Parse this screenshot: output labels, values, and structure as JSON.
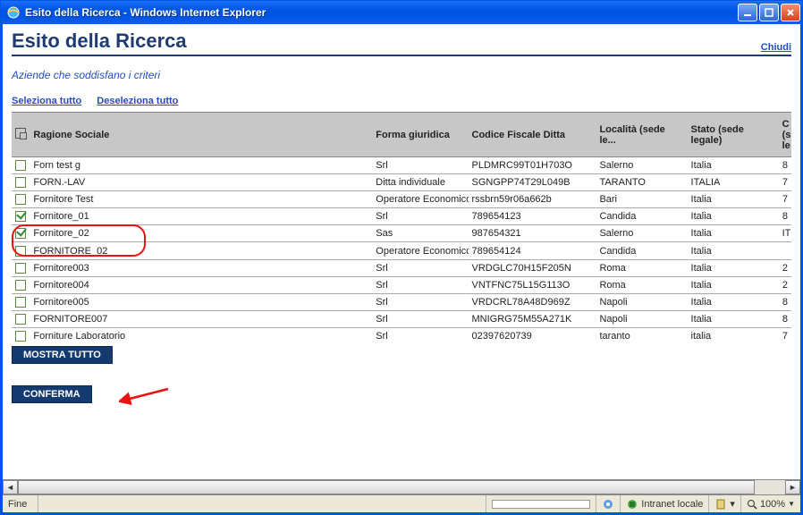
{
  "window": {
    "title": "Esito della Ricerca - Windows Internet Explorer"
  },
  "page": {
    "title": "Esito della Ricerca",
    "close_link": "Chiudi",
    "subtitle": "Aziende che soddisfano i criteri",
    "select_all": "Seleziona tutto",
    "deselect_all": "Deseleziona tutto"
  },
  "grid": {
    "headers": {
      "ragione": "Ragione Sociale",
      "forma": "Forma giuridica",
      "codice": "Codice Fiscale Ditta",
      "localita": "Località (sede le...",
      "stato": "Stato (sede legale)",
      "last": "C (s le"
    },
    "rows": [
      {
        "checked": false,
        "ragione": "Forn test g",
        "forma": "Srl",
        "codice": "PLDMRC99T01H703O",
        "localita": "Salerno",
        "stato": "Italia",
        "last": "8"
      },
      {
        "checked": false,
        "ragione": "FORN.-LAV",
        "forma": "Ditta individuale",
        "codice": "SGNGPP74T29L049B",
        "localita": "TARANTO",
        "stato": "ITALIA",
        "last": "7"
      },
      {
        "checked": false,
        "ragione": "Fornitore Test",
        "forma": "Operatore Economico Direttiva Europea",
        "codice": "rssbrn59r06a662b",
        "localita": "Bari",
        "stato": "Italia",
        "last": "7"
      },
      {
        "checked": true,
        "ragione": "Fornitore_01",
        "forma": "Srl",
        "codice": "789654123",
        "localita": "Candida",
        "stato": "Italia",
        "last": "8"
      },
      {
        "checked": true,
        "ragione": "Fornitore_02",
        "forma": "Sas",
        "codice": "987654321",
        "localita": "Salerno",
        "stato": "Italia",
        "last": "IT"
      },
      {
        "checked": false,
        "ragione": "FORNITORE_02",
        "forma": "Operatore Economico Direttiva Europea",
        "codice": "789654124",
        "localita": "Candida",
        "stato": "Italia",
        "last": ""
      },
      {
        "checked": false,
        "ragione": "Fornitore003",
        "forma": "Srl",
        "codice": "VRDGLC70H15F205N",
        "localita": "Roma",
        "stato": "Italia",
        "last": "2"
      },
      {
        "checked": false,
        "ragione": "Fornitore004",
        "forma": "Srl",
        "codice": "VNTFNC75L15G113O",
        "localita": "Roma",
        "stato": "Italia",
        "last": "2"
      },
      {
        "checked": false,
        "ragione": "Fornitore005",
        "forma": "Srl",
        "codice": "VRDCRL78A48D969Z",
        "localita": "Napoli",
        "stato": "Italia",
        "last": "8"
      },
      {
        "checked": false,
        "ragione": "FORNITORE007",
        "forma": "Srl",
        "codice": "MNIGRG75M55A271K",
        "localita": "Napoli",
        "stato": "Italia",
        "last": "8"
      },
      {
        "checked": false,
        "ragione": "Forniture Laboratorio",
        "forma": "Srl",
        "codice": "02397620739",
        "localita": "taranto",
        "stato": "italia",
        "last": "7"
      }
    ]
  },
  "buttons": {
    "mostra": "MOSTRA TUTTO",
    "conferma": "CONFERMA"
  },
  "statusbar": {
    "left": "Fine",
    "zone": "Intranet locale",
    "zoom": "100%"
  }
}
